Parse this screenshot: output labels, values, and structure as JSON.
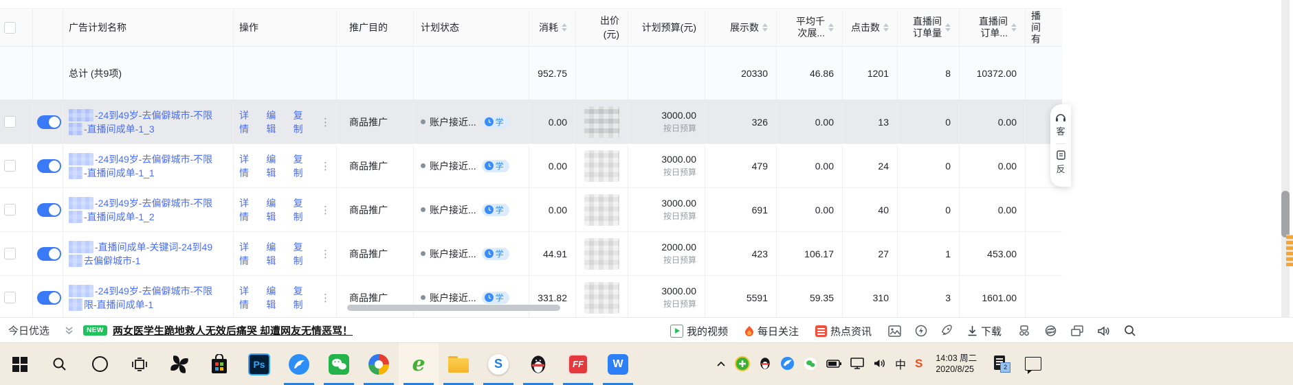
{
  "table": {
    "headers": {
      "name": "广告计划名称",
      "ops": "操作",
      "purpose": "推广目的",
      "status": "计划状态",
      "cost": "消耗",
      "bid": "出价(元)",
      "budget": "计划预算(元)",
      "impressions": "展示数",
      "cpm_line1": "平均千",
      "cpm_line2": "次展...",
      "clicks": "点击数",
      "orders_line1": "直播间",
      "orders_line2": "订单量",
      "amount_line1": "直播间",
      "amount_line2": "订单...",
      "extra_line1": "直播间",
      "extra_line2": "有效..."
    },
    "ops": {
      "detail": "详情",
      "edit": "编辑",
      "copy": "复制",
      "more": "⋮"
    },
    "total": {
      "label": "总计 (共9项)",
      "cost": "952.75",
      "impressions": "20330",
      "cpm": "46.86",
      "clicks": "1201",
      "orders": "8",
      "amount": "10372.00"
    },
    "rows": [
      {
        "name_line1": "-24到49岁-去偏僻城市-不限",
        "name_line2": "-直播间成单-1_3",
        "purpose": "商品推广",
        "status": "账户接近...",
        "badge": "学",
        "cost": "0.00",
        "budget": "3000.00",
        "budget_type": "按日预算",
        "impressions": "326",
        "cpm": "0.00",
        "clicks": "13",
        "orders": "0",
        "amount": "0.00",
        "highlighted": true
      },
      {
        "name_line1": "-24到49岁-去偏僻城市-不限",
        "name_line2": "-直播间成单-1_1",
        "purpose": "商品推广",
        "status": "账户接近...",
        "badge": "学",
        "cost": "0.00",
        "budget": "3000.00",
        "budget_type": "按日预算",
        "impressions": "479",
        "cpm": "0.00",
        "clicks": "24",
        "orders": "0",
        "amount": "0.00",
        "highlighted": false
      },
      {
        "name_line1": "-24到49岁-去偏僻城市-不限",
        "name_line2": "-直播间成单-1_2",
        "purpose": "商品推广",
        "status": "账户接近...",
        "badge": "学",
        "cost": "0.00",
        "budget": "3000.00",
        "budget_type": "按日预算",
        "impressions": "691",
        "cpm": "0.00",
        "clicks": "40",
        "orders": "0",
        "amount": "0.00",
        "highlighted": false
      },
      {
        "name_line1": "-直播间成单-关键词-24到49",
        "name_line2": "去偏僻城市-1",
        "purpose": "商品推广",
        "status": "账户接近...",
        "badge": "学",
        "cost": "44.91",
        "budget": "2000.00",
        "budget_type": "按日预算",
        "impressions": "423",
        "cpm": "106.17",
        "clicks": "27",
        "orders": "1",
        "amount": "453.00",
        "highlighted": false
      },
      {
        "name_line1": "-24到49岁-去偏僻城市-不限",
        "name_line2": "限-直播间成单-1",
        "purpose": "商品推广",
        "status": "账户接近...",
        "badge": "学",
        "cost": "331.82",
        "budget": "3000.00",
        "budget_type": "按日预算",
        "impressions": "5591",
        "cpm": "59.35",
        "clicks": "310",
        "orders": "3",
        "amount": "1601.00",
        "highlighted": false
      }
    ]
  },
  "floating": {
    "service": "客",
    "feedback": "反"
  },
  "news_bar": {
    "channel": "今日优选",
    "new_badge": "NEW",
    "headline": "两女医学生跪地救人无效后痛哭 却遭网友无情恶骂！",
    "my_videos": "我的视频",
    "daily_follow": "每日关注",
    "hot_news": "热点资讯",
    "download": "下载"
  },
  "taskbar": {
    "ps_label": "Ps",
    "e_label": "e",
    "sogou_label": "S",
    "ff_label": "FF",
    "w_label": "W",
    "ime_indicator": "中",
    "sogou_tray_label": "S",
    "time": "14:03 周二",
    "date": "2020/8/25",
    "notification_count": "2"
  }
}
